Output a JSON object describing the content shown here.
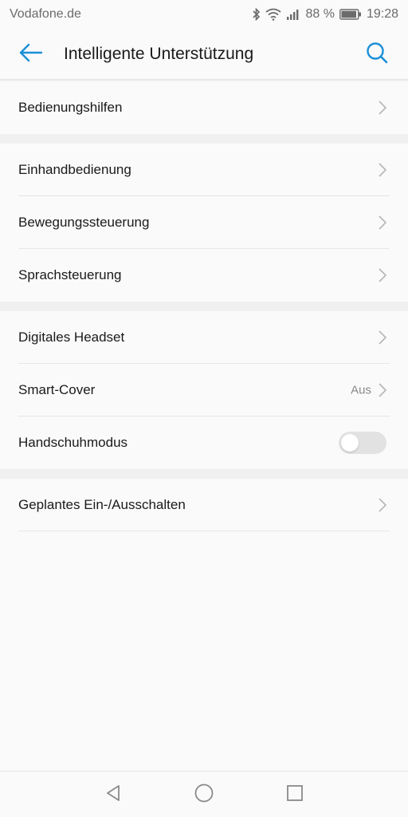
{
  "status_bar": {
    "carrier": "Vodafone.de",
    "battery_percent": "88 %",
    "time": "19:28",
    "icons": [
      "bluetooth-icon",
      "wifi-icon",
      "signal-icon",
      "battery-icon"
    ]
  },
  "app_bar": {
    "title": "Intelligente Unterstützung",
    "back_icon": "arrow-left-icon",
    "search_icon": "search-icon",
    "accent_color": "#1a8fd8"
  },
  "groups": [
    {
      "items": [
        {
          "label": "Bedienungshilfen",
          "type": "link"
        }
      ]
    },
    {
      "items": [
        {
          "label": "Einhandbedienung",
          "type": "link"
        },
        {
          "label": "Bewegungssteuerung",
          "type": "link"
        },
        {
          "label": "Sprachsteuerung",
          "type": "link"
        }
      ]
    },
    {
      "items": [
        {
          "label": "Digitales Headset",
          "type": "link"
        },
        {
          "label": "Smart-Cover",
          "type": "link",
          "value": "Aus"
        },
        {
          "label": "Handschuhmodus",
          "type": "toggle",
          "enabled": false
        }
      ]
    },
    {
      "items": [
        {
          "label": "Geplantes Ein-/Ausschalten",
          "type": "link"
        }
      ]
    }
  ],
  "nav_bar": {
    "icons": [
      "back-triangle-icon",
      "home-circle-icon",
      "recents-square-icon"
    ]
  }
}
